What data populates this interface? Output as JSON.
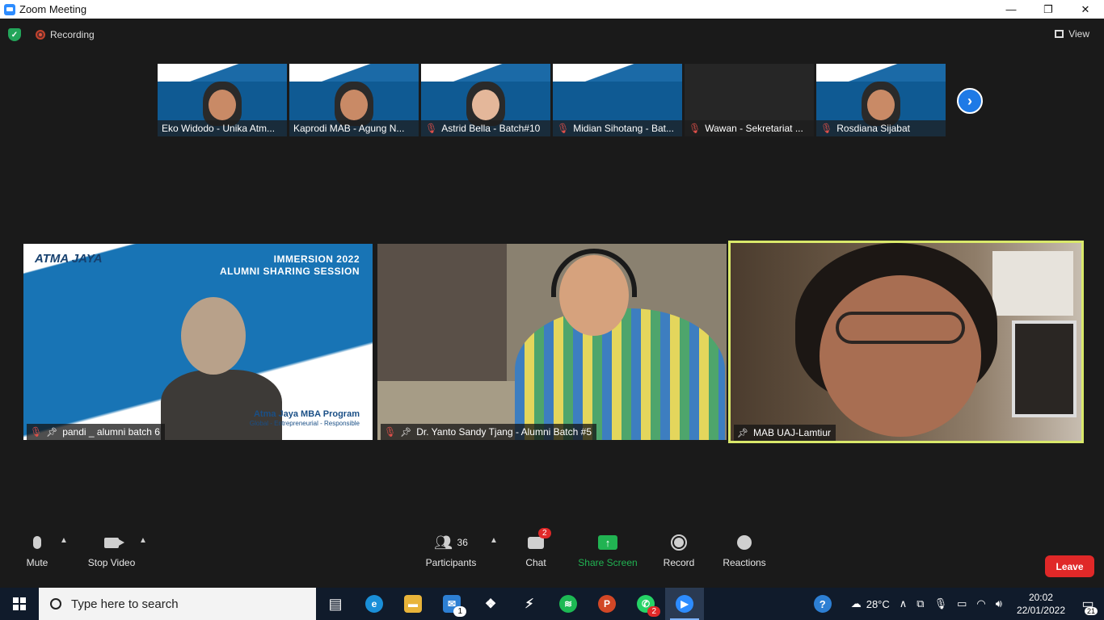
{
  "window": {
    "title": "Zoom Meeting",
    "minimize": "—",
    "restore": "❐",
    "close": "✕"
  },
  "status": {
    "recording": "Recording",
    "view": "View"
  },
  "thumbnails": [
    {
      "name": "Eko Widodo - Unika Atm...",
      "muted": false
    },
    {
      "name": "Kaprodi MAB - Agung N...",
      "muted": false
    },
    {
      "name": "Astrid Bella - Batch#10",
      "muted": true
    },
    {
      "name": "Midian Sihotang - Bat...",
      "muted": true
    },
    {
      "name": "Wawan - Sekretariat ...",
      "muted": true
    },
    {
      "name": "Rosdiana Sijabat",
      "muted": true
    }
  ],
  "gallery": [
    {
      "name": "pandi _ alumni batch 6",
      "slide_logo": "ATMA JAYA",
      "slide_title1": "IMMERSION 2022",
      "slide_title2": "ALUMNI SHARING SESSION",
      "slide_program": "Atma Jaya MBA Program",
      "slide_tagline": "Global - Entrepreneurial - Responsible"
    },
    {
      "name": "Dr. Yanto Sandy Tjang - Alumni Batch #5"
    },
    {
      "name": "MAB UAJ-Lamtiur"
    }
  ],
  "toolbar": {
    "mute": "Mute",
    "stop_video": "Stop Video",
    "participants": "Participants",
    "participants_count": "36",
    "chat": "Chat",
    "chat_badge": "2",
    "share_screen": "Share Screen",
    "record": "Record",
    "reactions": "Reactions",
    "leave": "Leave"
  },
  "taskbar": {
    "search_placeholder": "Type here to search",
    "mail_badge": "1",
    "whatsapp_badge": "2",
    "weather": "28°C",
    "time": "20:02",
    "date": "22/01/2022",
    "notifications": "21"
  },
  "colors": {
    "accent": "#2d8cff",
    "share": "#21b352",
    "leave": "#e02828",
    "active_speaker": "#d9e86a"
  }
}
